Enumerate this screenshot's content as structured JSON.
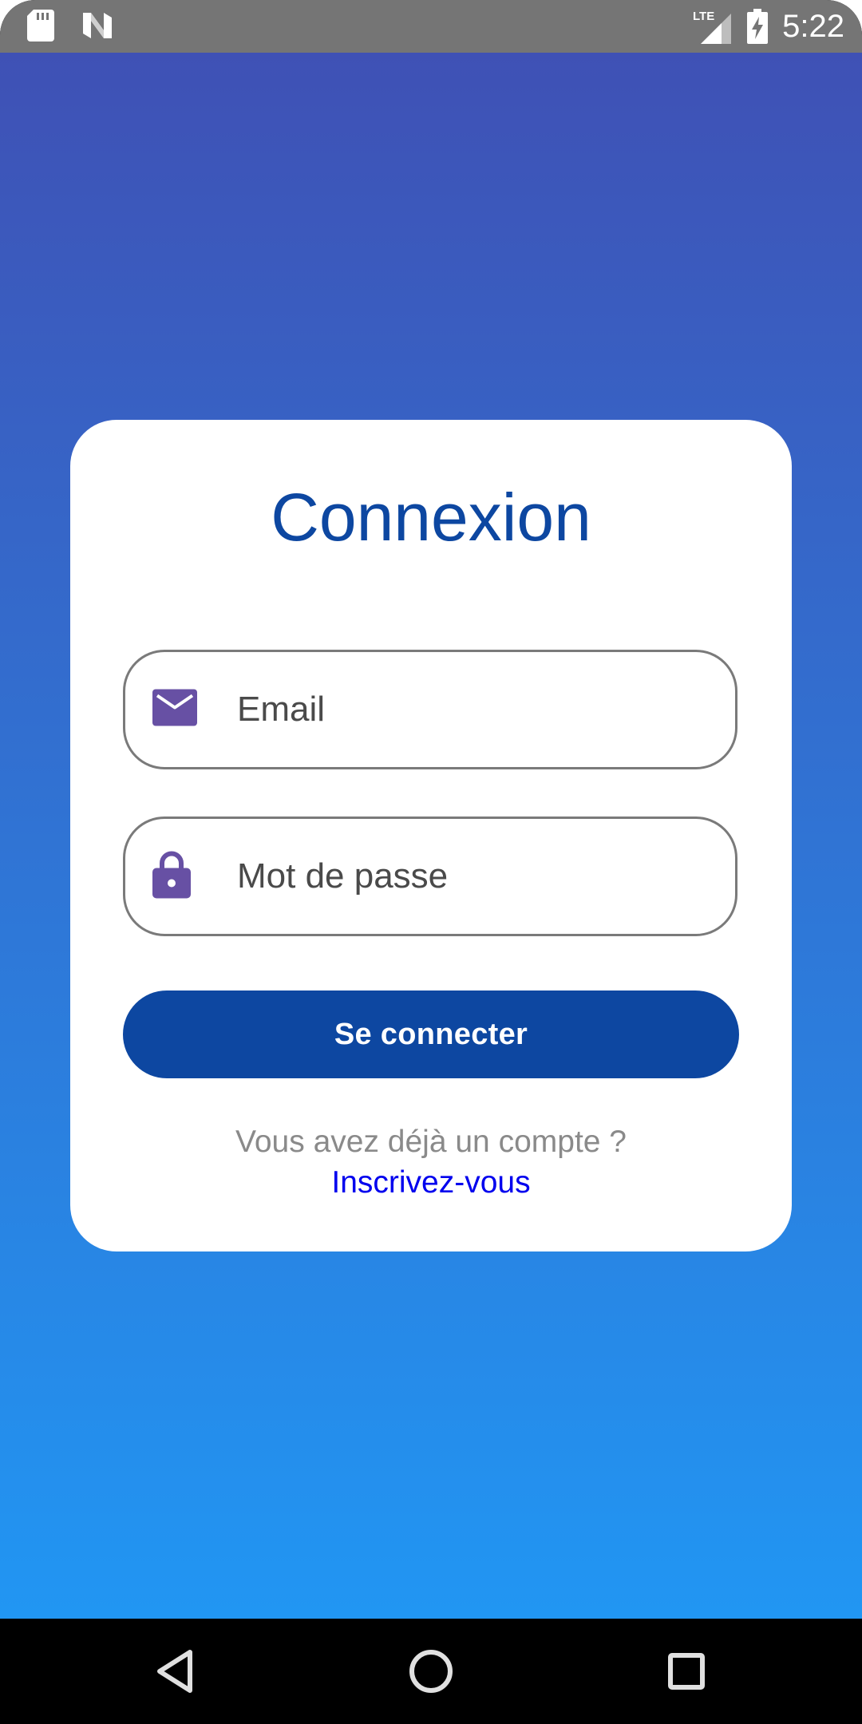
{
  "status_bar": {
    "time": "5:22",
    "network": "LTE",
    "icons": [
      "sd-card-icon",
      "n-logo-icon",
      "signal-icon",
      "battery-charging-icon"
    ]
  },
  "login": {
    "title": "Connexion",
    "email_placeholder": "Email",
    "password_placeholder": "Mot de passe",
    "submit_label": "Se connecter",
    "account_prompt": "Vous avez déjà un compte ?",
    "signup_link": "Inscrivez-vous"
  },
  "colors": {
    "gradient_top": "#3F51B5",
    "gradient_bottom": "#2196F3",
    "primary": "#0D47A1",
    "icon": "#6750A4",
    "link": "#0000EE"
  },
  "nav_bar": {
    "buttons": [
      "back-icon",
      "home-icon",
      "recents-icon"
    ]
  }
}
